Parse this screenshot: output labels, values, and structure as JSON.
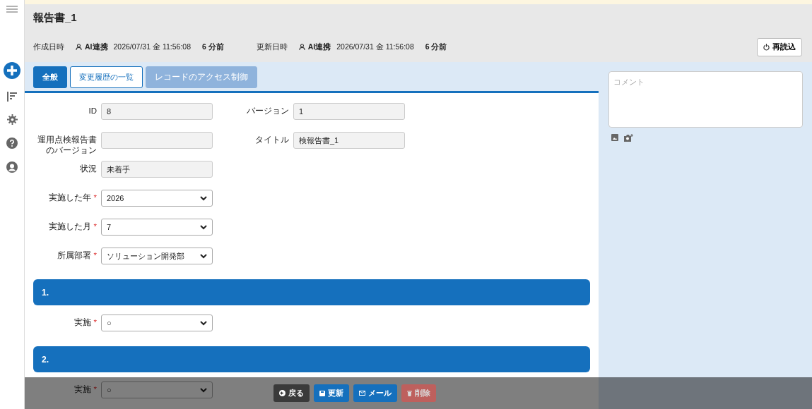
{
  "header": {
    "title": "報告書_1",
    "meta": [
      {
        "label": "作成日時",
        "user": "AI連携",
        "datetime": "2026/07/31 金 11:56:08",
        "ago": "6 分前"
      },
      {
        "label": "更新日時",
        "user": "AI連携",
        "datetime": "2026/07/31 金 11:56:08",
        "ago": "6 分前"
      }
    ],
    "reload_button": "再読込"
  },
  "tabs": [
    {
      "label": "全般",
      "selected": true,
      "disabled": false
    },
    {
      "label": "変更履歴の一覧",
      "selected": false,
      "disabled": false
    },
    {
      "label": "レコードのアクセス制御",
      "selected": false,
      "disabled": true
    }
  ],
  "form_rows": [
    {
      "fields": [
        {
          "label": "ID",
          "value": "8",
          "kind": "readonly"
        },
        {
          "label": "バージョン",
          "value": "1",
          "kind": "readonly"
        }
      ]
    },
    {
      "fields": [
        {
          "label": "運用点検報告書のバージョン",
          "kind": "readonly"
        },
        {
          "label": "タイトル",
          "value": "検報告書_1",
          "kind": "readonly"
        }
      ]
    },
    {
      "fields": [
        {
          "label": "状況",
          "value": "未着手",
          "kind": "readonly"
        }
      ]
    },
    {
      "fields": [
        {
          "label": "実施した年",
          "value": "2026",
          "kind": "select",
          "required": "*"
        }
      ]
    },
    {
      "fields": [
        {
          "label": "実施した月",
          "value": "7",
          "kind": "select",
          "required": "*"
        }
      ]
    },
    {
      "fields": [
        {
          "label": "所属部署",
          "value": "ソリューション開発部",
          "kind": "select",
          "required": "*"
        }
      ]
    }
  ],
  "sections": [
    {
      "heading": "1.",
      "field": {
        "label": "実施",
        "value": "○",
        "kind": "select",
        "required": "*"
      }
    },
    {
      "heading": "2.",
      "field": {
        "label": "実施",
        "value": "○",
        "kind": "select",
        "required": "*"
      }
    }
  ],
  "comment": {
    "placeholder": "コメント"
  },
  "actions": [
    {
      "label": "戻る",
      "kind": "back",
      "disabled": false
    },
    {
      "label": "更新",
      "kind": "update",
      "disabled": false
    },
    {
      "label": "メール",
      "kind": "mail",
      "disabled": false
    },
    {
      "label": "削除",
      "kind": "delete",
      "disabled": true
    }
  ]
}
